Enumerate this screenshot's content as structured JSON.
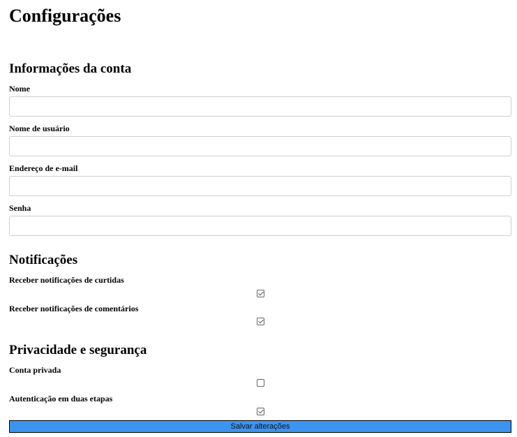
{
  "page": {
    "title": "Configurações"
  },
  "account": {
    "title": "Informações da conta",
    "name_label": "Nome",
    "name_value": "",
    "username_label": "Nome de usuário",
    "username_value": "",
    "email_label": "Endereço de e-mail",
    "email_value": "",
    "password_label": "Senha",
    "password_value": ""
  },
  "notifications": {
    "title": "Notificações",
    "likes_label": "Receber notificações de curtidas",
    "likes_checked": true,
    "comments_label": "Receber notificações de comentários",
    "comments_checked": true
  },
  "privacy": {
    "title": "Privacidade e segurança",
    "private_label": "Conta privada",
    "private_checked": false,
    "twofa_label": "Autenticação em duas etapas",
    "twofa_checked": true
  },
  "actions": {
    "save_label": "Salvar alterações"
  }
}
